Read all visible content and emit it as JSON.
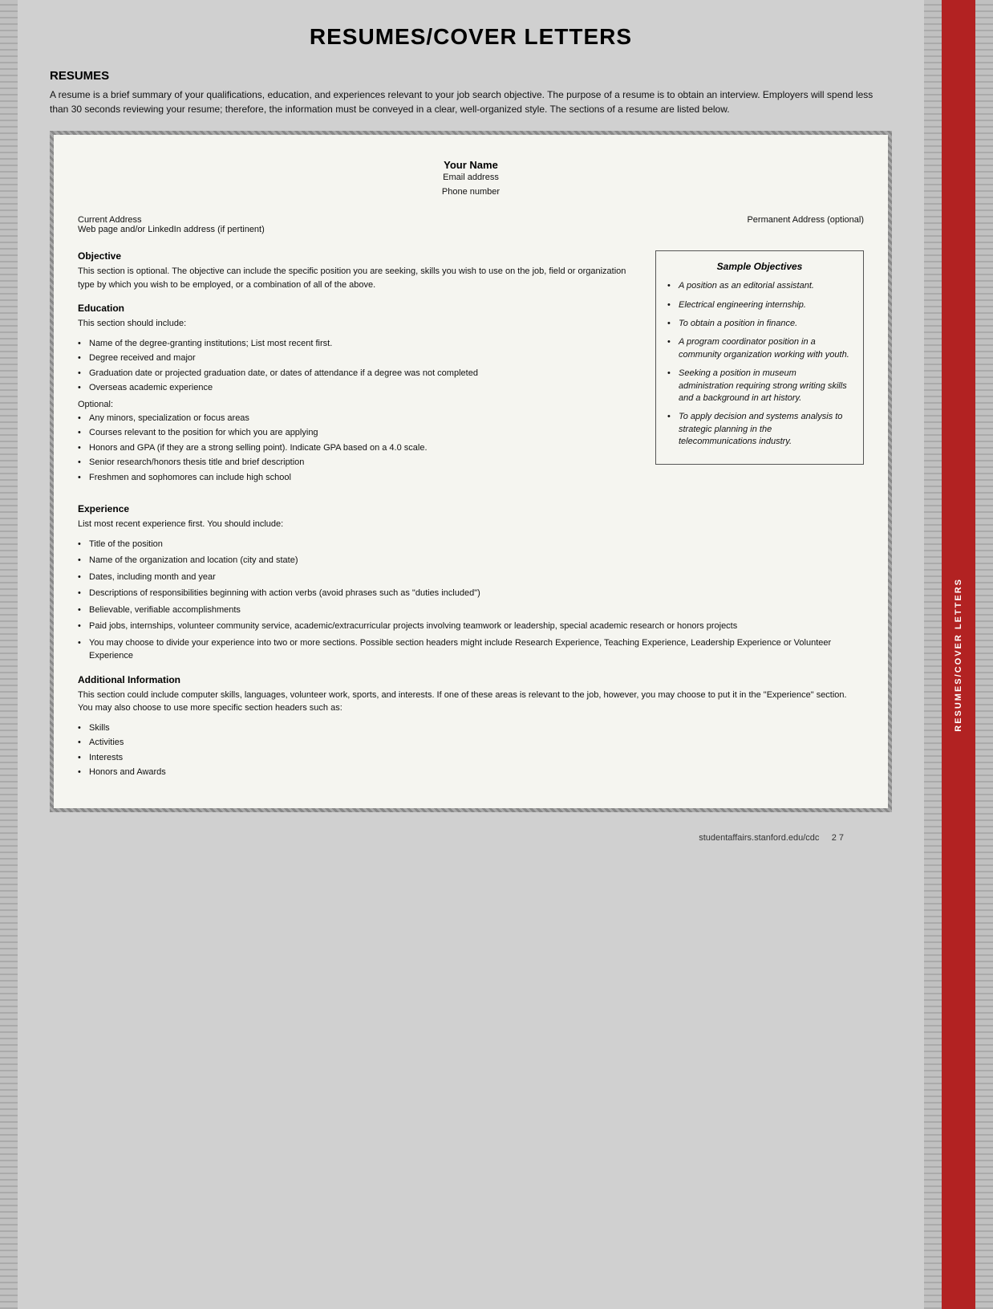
{
  "page": {
    "title": "RESUMES/COVER LETTERS",
    "footer": {
      "url": "studentaffairs.stanford.edu/cdc",
      "page": "2 7"
    }
  },
  "sidebar": {
    "label": "RESUMES/COVER LETTERS"
  },
  "resumes_section": {
    "heading": "RESUMES",
    "intro": "A resume is a brief summary of your qualifications, education, and experiences relevant to your job search objective. The purpose of a resume is to obtain an interview. Employers will spend less than 30 seconds reviewing your resume; therefore, the information must be conveyed in a clear, well-organized style. The sections of a resume are listed below."
  },
  "resume_template": {
    "header": {
      "name": "Your Name",
      "email": "Email address",
      "phone": "Phone number"
    },
    "address": {
      "current": "Current Address",
      "web": "Web page and/or LinkedIn address (if pertinent)",
      "permanent": "Permanent Address (optional)"
    },
    "objective": {
      "title": "Objective",
      "text": "This section is optional. The objective can include the specific position you are seeking, skills you wish to use on the job, field or organization type by which you wish to be employed, or a combination of all of the above."
    },
    "sample_objectives": {
      "title": "Sample Objectives",
      "items": [
        "A position as an editorial assistant.",
        "Electrical engineering internship.",
        "To obtain a position in finance.",
        "A program coordinator position in a community organization working with youth.",
        "Seeking a position in museum administration requiring strong writing skills and a background in art history.",
        "To apply decision and systems analysis to strategic planning in the telecommunications industry."
      ]
    },
    "education": {
      "title": "Education",
      "intro": "This section should include:",
      "required_bullets": [
        "Name of the degree-granting institutions; List most recent first.",
        "Degree received and major",
        "Graduation date or projected graduation date, or dates of attendance if a degree was not completed",
        "Overseas academic experience"
      ],
      "optional_label": "Optional:",
      "optional_bullets": [
        "Any minors, specialization or focus areas",
        "Courses relevant to the position for which you are applying",
        "Honors and GPA (if they are a strong selling point). Indicate GPA based on a 4.0 scale.",
        "Senior research/honors thesis title and brief description",
        "Freshmen and sophomores can include high school"
      ]
    },
    "experience": {
      "title": "Experience",
      "intro": "List most recent experience first. You should include:",
      "bullets": [
        "Title of the position",
        "Name of the organization and location (city and state)",
        "Dates, including month and year",
        "Descriptions of responsibilities beginning with action verbs (avoid phrases such as \"duties included\")",
        "Believable, verifiable accomplishments",
        "Paid jobs, internships, volunteer community service, academic/extracurricular projects involving teamwork or leadership, special academic research or honors projects",
        "You may choose to divide your experience into two or more sections. Possible section headers might include Research Experience, Teaching Experience, Leadership Experience or Volunteer Experience"
      ]
    },
    "additional_info": {
      "title": "Additional Information",
      "text": "This section could include computer skills, languages, volunteer work, sports, and interests. If one of these areas is relevant to the job, however, you may choose to put it in the \"Experience\" section. You may also choose to use more specific section headers such as:",
      "bullets": [
        "Skills",
        "Activities",
        "Interests",
        "Honors and Awards"
      ]
    }
  }
}
